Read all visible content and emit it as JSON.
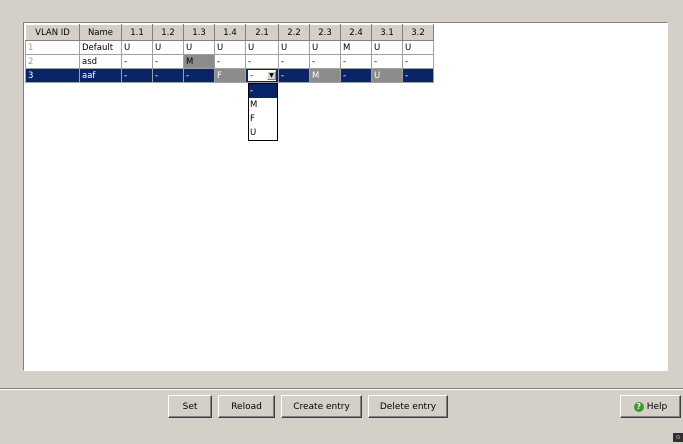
{
  "table": {
    "columns": [
      "VLAN ID",
      "Name",
      "1.1",
      "1.2",
      "1.3",
      "1.4",
      "2.1",
      "2.2",
      "2.3",
      "2.4",
      "3.1",
      "3.2"
    ],
    "rows": [
      {
        "id": "1",
        "name": "Default",
        "ports": [
          "U",
          "U",
          "U",
          "U",
          "U",
          "U",
          "U",
          "M",
          "U",
          "U"
        ]
      },
      {
        "id": "2",
        "name": "asd",
        "ports": [
          "-",
          "-",
          "M",
          "-",
          "-",
          "-",
          "-",
          "-",
          "-",
          "-"
        ]
      },
      {
        "id": "3",
        "name": "aaf",
        "ports": [
          "-",
          "-",
          "-",
          "F",
          "-",
          "-",
          "M",
          "-",
          "U",
          "-"
        ]
      }
    ],
    "editing_value": "-"
  },
  "dropdown": {
    "options": [
      "-",
      "M",
      "F",
      "U"
    ],
    "selected_index": 0
  },
  "buttons": {
    "set": "Set",
    "reload": "Reload",
    "create": "Create entry",
    "delete": "Delete entry",
    "help": "Help"
  },
  "icons": {
    "combo_arrow": "chevron-down-icon",
    "help": "help-icon",
    "corner": "resize-grip-icon"
  },
  "colors": {
    "background": "#d4d0c8",
    "selection": "#0a246a",
    "modified_cell": "#8c8c8c"
  }
}
